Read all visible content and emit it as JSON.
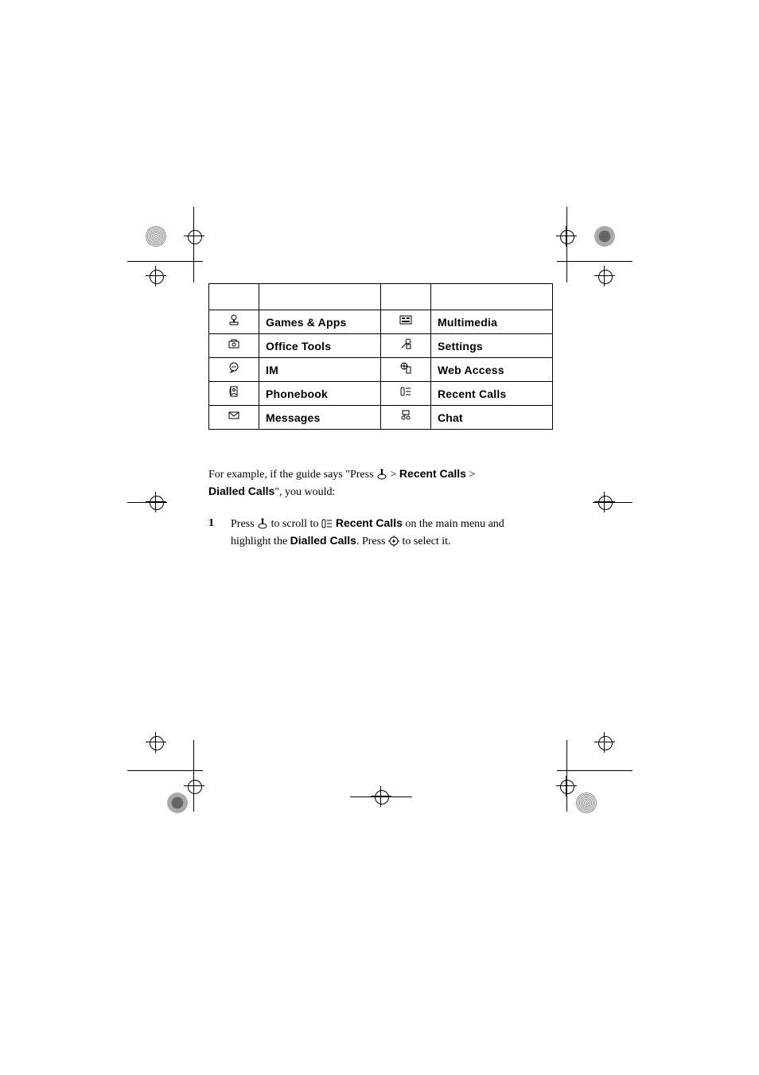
{
  "menu_table": {
    "rows": [
      {
        "left_icon": "joystick-icon",
        "left_label": "Games & Apps",
        "right_icon": "multimedia-icon",
        "right_label": "Multimedia"
      },
      {
        "left_icon": "briefcase-icon",
        "left_label": "Office Tools",
        "right_icon": "tools-icon",
        "right_label": "Settings"
      },
      {
        "left_icon": "speech-bubble-icon",
        "left_label": "IM",
        "right_icon": "globe-phone-icon",
        "right_label": "Web Access"
      },
      {
        "left_icon": "phonebook-icon",
        "left_label": "Phonebook",
        "right_icon": "handset-log-icon",
        "right_label": "Recent Calls"
      },
      {
        "left_icon": "envelope-icon",
        "left_label": "Messages",
        "right_icon": "people-chat-icon",
        "right_label": "Chat"
      }
    ]
  },
  "body": {
    "p1_prefix": "For example, if the guide says \"Press ",
    "p1_gt": " > ",
    "p1_b1": "Recent Calls",
    "p1_b2": "Dialled Calls",
    "p1_suffix": "\", you would:",
    "step_num": "1",
    "s1": "Press ",
    "s2": " to scroll to ",
    "s3": " Recent Calls",
    "s4": " on the main menu and highlight the ",
    "s5": "Dialled Calls",
    "s6": ". Press ",
    "s7": " to select it."
  }
}
